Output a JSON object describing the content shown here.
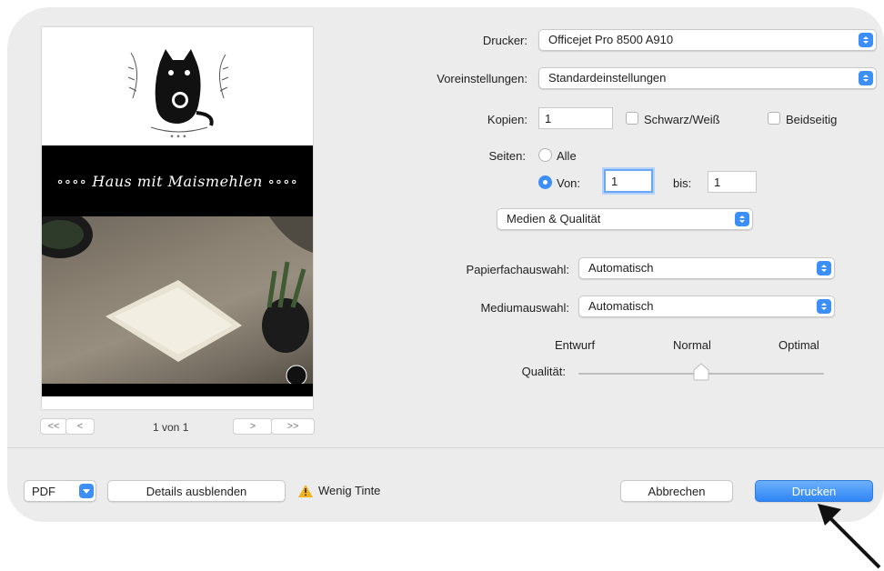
{
  "printer": {
    "label": "Drucker:",
    "value": "Officejet Pro 8500 A910"
  },
  "presets": {
    "label": "Voreinstellungen:",
    "value": "Standardeinstellungen"
  },
  "copies": {
    "label": "Kopien:",
    "value": "1",
    "bw_label": "Schwarz/Weiß",
    "duplex_label": "Beidseitig"
  },
  "pages": {
    "label": "Seiten:",
    "all_label": "Alle",
    "from_label": "Von:",
    "from_value": "1",
    "to_label": "bis:",
    "to_value": "1"
  },
  "section": {
    "value": "Medien & Qualität"
  },
  "paper_feed": {
    "label": "Papierfachauswahl:",
    "value": "Automatisch"
  },
  "media": {
    "label": "Mediumauswahl:",
    "value": "Automatisch"
  },
  "quality": {
    "label": "Qualität:",
    "ticks": [
      "Entwurf",
      "Normal",
      "Optimal"
    ],
    "selected": "Normal"
  },
  "preview": {
    "banner_text": "∘∘∘∘ Haus mit Maismehlen ∘∘∘∘",
    "page_indicator": "1 von 1",
    "first": "<<",
    "prev": "<",
    "next": ">",
    "last": ">>"
  },
  "footer": {
    "pdf_label": "PDF",
    "details_label": "Details ausblenden",
    "warning_text": "Wenig Tinte",
    "cancel_label": "Abbrechen",
    "print_label": "Drucken"
  },
  "colors": {
    "accent": "#3b8ff7",
    "warning": "#f2b21b"
  }
}
